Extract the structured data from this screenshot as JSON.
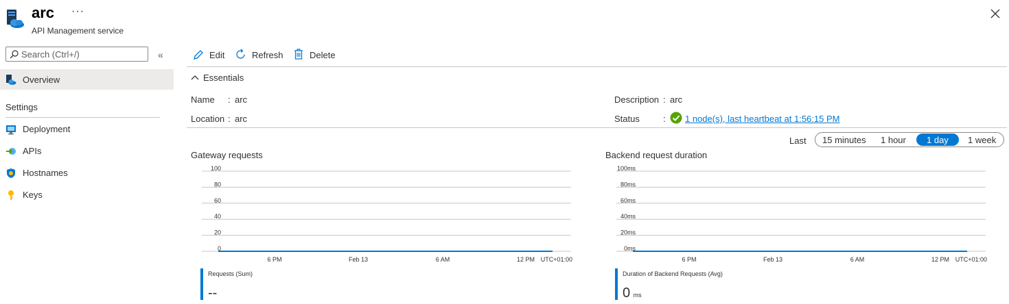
{
  "header": {
    "title": "arc",
    "subtitle": "API Management service",
    "more_label": "···",
    "close_icon": "close-icon"
  },
  "sidebar": {
    "search_placeholder": "Search (Ctrl+/)",
    "collapse_label": "«",
    "items": [
      {
        "label": "Overview",
        "icon": "api-management-icon",
        "active": true
      }
    ],
    "settings_header": "Settings",
    "settings_items": [
      {
        "label": "Deployment",
        "icon": "deployment-icon"
      },
      {
        "label": "APIs",
        "icon": "apis-icon"
      },
      {
        "label": "Hostnames",
        "icon": "shield-icon"
      },
      {
        "label": "Keys",
        "icon": "key-icon"
      }
    ]
  },
  "toolbar": {
    "edit_label": "Edit",
    "refresh_label": "Refresh",
    "delete_label": "Delete"
  },
  "essentials": {
    "title": "Essentials",
    "name_key": "Name",
    "name_value": "arc",
    "location_key": "Location",
    "location_value": "arc",
    "description_key": "Description",
    "description_value": "arc",
    "status_key": "Status",
    "status_value": "1 node(s), last heartbeat at 1:56:15 PM",
    "separator": ":"
  },
  "time_range": {
    "label": "Last",
    "options": [
      "15 minutes",
      "1 hour",
      "1 day",
      "1 week"
    ],
    "selected": "1 day"
  },
  "colors": {
    "accent": "#0078d4",
    "success": "#57a300"
  },
  "chart_data": [
    {
      "type": "line",
      "title": "Gateway requests",
      "y_ticks": [
        "100",
        "80",
        "60",
        "40",
        "20",
        "0"
      ],
      "ylim": [
        0,
        100
      ],
      "x_ticks": [
        "6 PM",
        "Feb 13",
        "6 AM",
        "12 PM"
      ],
      "timezone": "UTC+01:00",
      "grid": true,
      "series": [
        {
          "name": "Requests (Sum)",
          "values": [
            0,
            0
          ]
        }
      ],
      "legend_value": "--",
      "legend_unit": ""
    },
    {
      "type": "line",
      "title": "Backend request duration",
      "y_ticks": [
        "100ms",
        "80ms",
        "60ms",
        "40ms",
        "20ms",
        "0ms"
      ],
      "ylim": [
        0,
        100
      ],
      "x_ticks": [
        "6 PM",
        "Feb 13",
        "6 AM",
        "12 PM"
      ],
      "timezone": "UTC+01:00",
      "grid": true,
      "series": [
        {
          "name": "Duration of Backend Requests (Avg)",
          "values": [
            0,
            0
          ]
        }
      ],
      "legend_value": "0",
      "legend_unit": "ms"
    }
  ]
}
